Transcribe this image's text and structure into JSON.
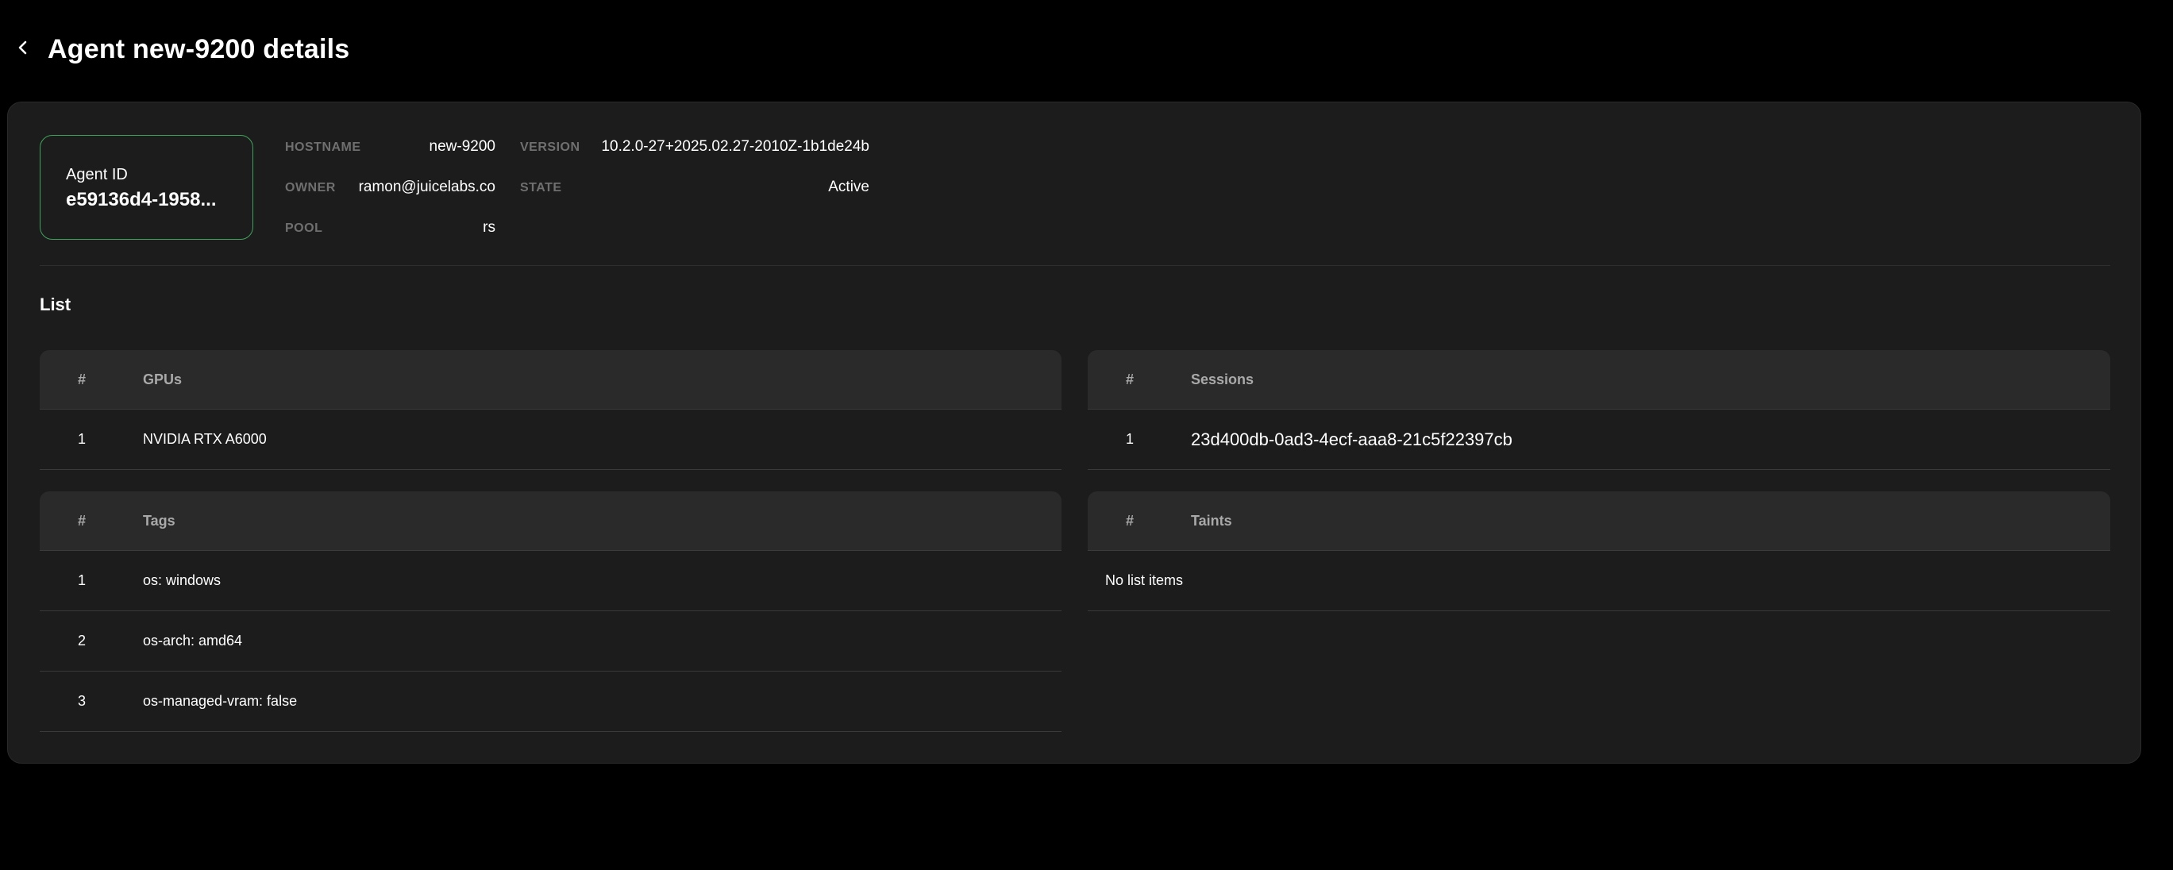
{
  "header": {
    "title": "Agent new-9200 details"
  },
  "agent_card": {
    "id_label": "Agent ID",
    "id_value": "e59136d4-1958..."
  },
  "meta": {
    "hostname_label": "HOSTNAME",
    "hostname_value": "new-9200",
    "owner_label": "OWNER",
    "owner_value": "ramon@juicelabs.co",
    "pool_label": "POOL",
    "pool_value": "rs",
    "version_label": "VERSION",
    "version_value": "10.2.0-27+2025.02.27-2010Z-1b1de24b",
    "state_label": "STATE",
    "state_value": "Active"
  },
  "list_section": {
    "title": "List"
  },
  "gpus_table": {
    "headers": [
      "#",
      "GPUs"
    ],
    "rows": [
      {
        "num": "1",
        "value": "NVIDIA RTX A6000"
      }
    ]
  },
  "sessions_table": {
    "headers": [
      "#",
      "Sessions"
    ],
    "rows": [
      {
        "num": "1",
        "value": "23d400db-0ad3-4ecf-aaa8-21c5f22397cb"
      }
    ]
  },
  "tags_table": {
    "headers": [
      "#",
      "Tags"
    ],
    "rows": [
      {
        "num": "1",
        "value": "os: windows"
      },
      {
        "num": "2",
        "value": "os-arch: amd64"
      },
      {
        "num": "3",
        "value": "os-managed-vram: false"
      }
    ]
  },
  "taints_table": {
    "headers": [
      "#",
      "Taints"
    ],
    "empty_text": "No list items"
  },
  "colors": {
    "background": "#000000",
    "card": "#1c1c1c",
    "table_header": "#2a2a2a",
    "accent_border": "#3fa35a",
    "muted_label": "#6f6f6f"
  },
  "icons": {
    "back": "chevron-left-icon"
  }
}
